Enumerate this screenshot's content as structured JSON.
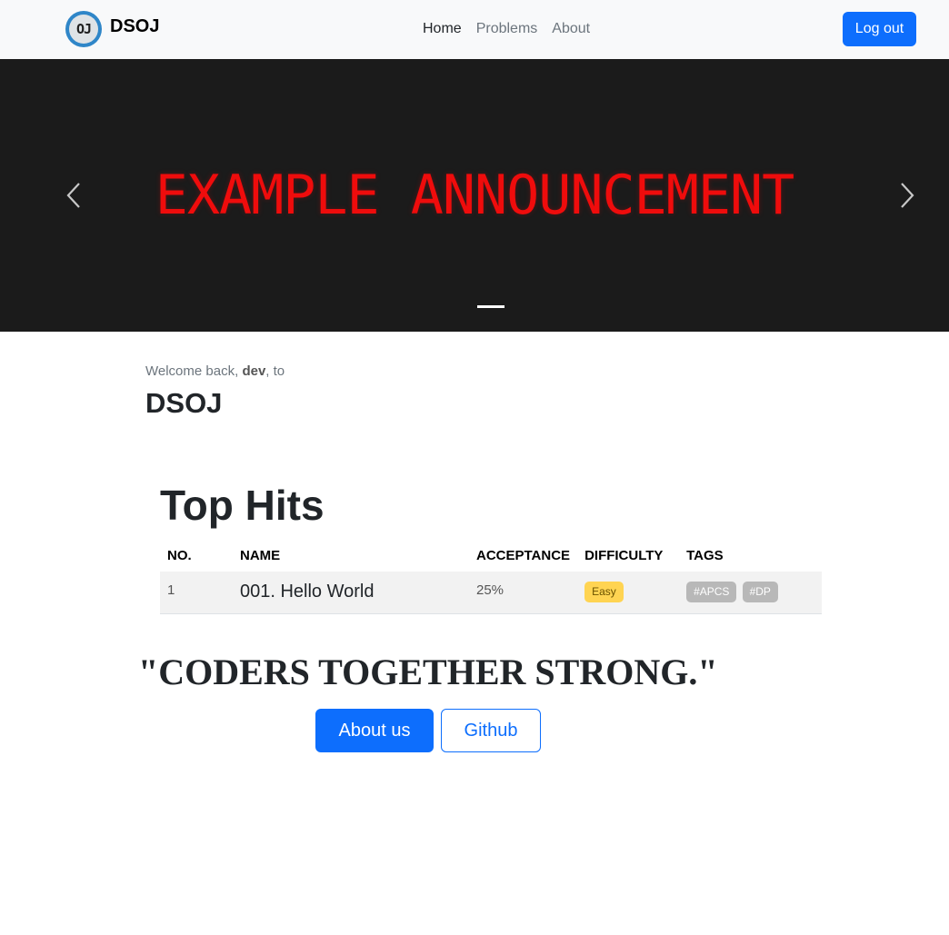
{
  "navbar": {
    "brand_logo_text": "OJ",
    "brand_name": "DSOJ",
    "links": [
      {
        "label": "Home",
        "active": true
      },
      {
        "label": "Problems",
        "active": false
      },
      {
        "label": "About",
        "active": false
      }
    ],
    "logout_label": "Log out"
  },
  "carousel": {
    "slide_text": "EXAMPLE ANNOUNCEMENT",
    "prev_icon": "chevron-left-icon",
    "next_icon": "chevron-right-icon",
    "slide_count": 1,
    "active_slide": 1
  },
  "welcome": {
    "prefix": "Welcome back, ",
    "username": "dev",
    "suffix": ", to",
    "site_title": "DSOJ"
  },
  "top_hits": {
    "title": "Top Hits",
    "columns": [
      "NO.",
      "NAME",
      "ACCEPTANCE",
      "DIFFICULTY",
      "TAGS"
    ],
    "rows": [
      {
        "no": "1",
        "name": "001. Hello World",
        "acceptance": "25%",
        "difficulty": "Easy",
        "tags": [
          "#APCS",
          "#DP"
        ]
      }
    ]
  },
  "quote": "\"CODERS TOGETHER STRONG.\"",
  "buttons": {
    "about_label": "About us",
    "github_label": "Github"
  },
  "colors": {
    "primary": "#0d6efd",
    "navbar_bg": "#f8f9fa",
    "carousel_bg": "#1b1b1b",
    "announcement": "#ef0c0c",
    "easy_badge": "#ffd452",
    "tag_badge": "#b8b8b8"
  }
}
